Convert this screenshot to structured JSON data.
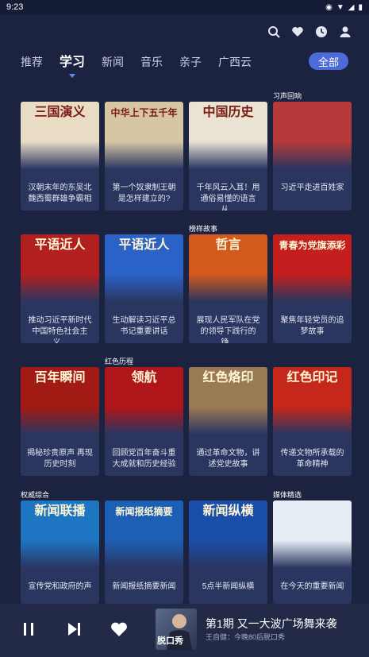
{
  "status": {
    "time": "9:23"
  },
  "top_icons": [
    "search-icon",
    "heart-icon",
    "clock-icon",
    "user-icon"
  ],
  "tabs": [
    "推荐",
    "学习",
    "新闻",
    "音乐",
    "亲子",
    "广西云"
  ],
  "active_tab": "学习",
  "all_button": "全部",
  "sections": {
    "s1": "习声回响",
    "s2": "榜样故事",
    "s3": "红色历程",
    "s4": "权威综合",
    "s5": "媒体精选"
  },
  "cards": [
    {
      "title": "三国演义",
      "desc": "汉朝末年的东吴北魏西蜀群雄争霸相",
      "color": "#e9dcc4"
    },
    {
      "title": "中华上下五千年",
      "desc": "第一个奴隶制王朝是怎样建立的?",
      "color": "#d7c6a4"
    },
    {
      "title": "中国历史",
      "desc": "千年风云入耳！用通俗易懂的语言从...",
      "color": "#eae2d3"
    },
    {
      "title": "",
      "desc": "习近平走进百姓家",
      "color": "#b63a39"
    },
    {
      "title": "平语近人",
      "desc": "推动习近平新时代中国特色社会主义...",
      "color": "#b21f1f"
    },
    {
      "title": "平语近人",
      "desc": "生动解读习近平总书记重要讲话",
      "color": "#2a62c7"
    },
    {
      "title": "哲言",
      "desc": "展现人民军队在党的领导下践行的铮...",
      "color": "#d35a1c"
    },
    {
      "title": "青春为党旗添彩",
      "desc": "聚焦年轻党员的追梦故事",
      "color": "#c41e1e"
    },
    {
      "title": "百年瞬间",
      "desc": "揭秘珍贵原声 再现历史时刻",
      "color": "#a21a14"
    },
    {
      "title": "领航",
      "desc": "回顾党百年奋斗重大成就和历史经验",
      "color": "#b0151a"
    },
    {
      "title": "红色烙印",
      "desc": "通过革命文物，讲述党史故事",
      "color": "#9a7a52"
    },
    {
      "title": "红色印记",
      "desc": "传递文物所承载的革命精神",
      "color": "#c5271b"
    },
    {
      "title": "新闻联播",
      "desc": "宣传党和政府的声",
      "color": "#1e75c2"
    },
    {
      "title": "新闻报纸摘要",
      "desc": "新闻报纸摘要新闻",
      "color": "#1c5fb5"
    },
    {
      "title": "新闻纵横",
      "desc": "5点半新闻纵横",
      "color": "#1b4ea8"
    },
    {
      "title": "",
      "desc": "在今天的重要新闻",
      "color": "#e8eef6"
    }
  ],
  "player": {
    "now_title": "第1期  又一大波广场舞来袭",
    "now_sub": "王自健：今晚80后脱口秀",
    "thumb_text": "脱口秀"
  }
}
